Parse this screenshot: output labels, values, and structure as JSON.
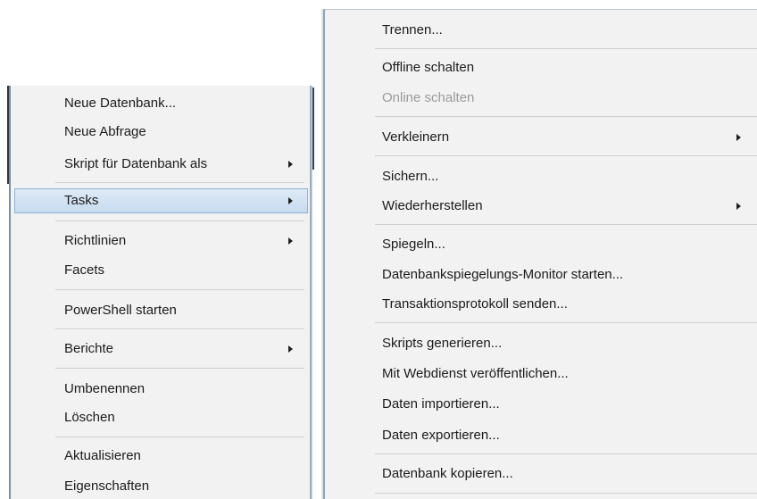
{
  "context_menu": {
    "items": [
      {
        "label": "Neue Datenbank..."
      },
      {
        "label": "Neue Abfrage"
      },
      {
        "label": "Skript für Datenbank als",
        "submenu": true
      },
      {
        "label": "Tasks",
        "submenu": true,
        "selected": true
      },
      {
        "label": "Richtlinien",
        "submenu": true
      },
      {
        "label": "Facets"
      },
      {
        "label": "PowerShell starten"
      },
      {
        "label": "Berichte",
        "submenu": true
      },
      {
        "label": "Umbenennen"
      },
      {
        "label": "Löschen"
      },
      {
        "label": "Aktualisieren"
      },
      {
        "label": "Eigenschaften"
      }
    ]
  },
  "tasks_submenu": {
    "items": [
      {
        "label": "Trennen..."
      },
      {
        "label": "Offline schalten"
      },
      {
        "label": "Online schalten",
        "disabled": true
      },
      {
        "label": "Verkleinern",
        "submenu": true
      },
      {
        "label": "Sichern..."
      },
      {
        "label": "Wiederherstellen",
        "submenu": true
      },
      {
        "label": "Spiegeln..."
      },
      {
        "label": "Datenbankspiegelungs-Monitor starten..."
      },
      {
        "label": "Transaktionsprotokoll senden..."
      },
      {
        "label": "Skripts generieren..."
      },
      {
        "label": "Mit Webdienst veröffentlichen..."
      },
      {
        "label": "Daten importieren..."
      },
      {
        "label": "Daten exportieren..."
      },
      {
        "label": "Datenbank kopieren..."
      }
    ]
  },
  "colors": {
    "menu_background": "#f2f2f2",
    "selection_fill": "#c7dbf0",
    "selection_border": "#8fb0d6",
    "disabled_text": "#9a9a9a"
  }
}
